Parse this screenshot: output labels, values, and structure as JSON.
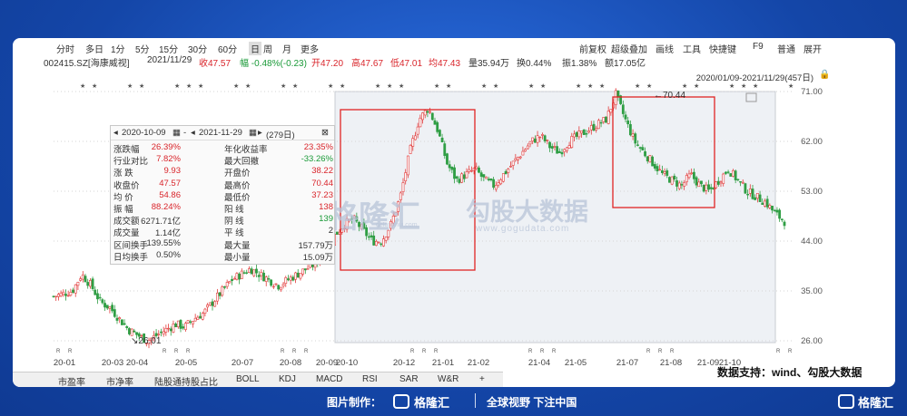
{
  "toolbar": {
    "left": [
      "分时",
      "多日",
      "1分",
      "5分",
      "15分",
      "30分",
      "60分",
      "日",
      "周",
      "月",
      "更多"
    ],
    "right": [
      "前复权",
      "超级叠加",
      "画线",
      "工具",
      "快捷键",
      "F9",
      "普通",
      "展开"
    ]
  },
  "quote": {
    "code": "002415.SZ[海康威视]",
    "date": "2021/11/29",
    "close": "收47.57",
    "change": "幅 -0.48%(-0.23)",
    "open": "开47.20",
    "high": "高47.67",
    "low": "低47.01",
    "avg": "均47.43",
    "volume": "量35.94万",
    "turnover": "换0.44%",
    "amplitude": "振1.38%",
    "amount": "额17.05亿"
  },
  "range_label": "2020/01/09-2021/11/29(457日)",
  "stats": {
    "start": "2020-10-09",
    "end": "2021-11-29",
    "days": "(279日)",
    "rows": [
      {
        "l1": "涨跌幅",
        "v1": "26.39%",
        "l2": "年化收益率",
        "v2": "23.35%",
        "c1": "red",
        "c2": "red"
      },
      {
        "l1": "行业对比",
        "v1": "7.82%",
        "l2": "最大回撤",
        "v2": "-33.26%",
        "c1": "red",
        "c2": "green"
      },
      {
        "l1": "涨 跌",
        "v1": "9.93",
        "l2": "开盘价",
        "v2": "38.22",
        "c1": "red",
        "c2": "red"
      },
      {
        "l1": "收盘价",
        "v1": "47.57",
        "l2": "最高价",
        "v2": "70.44",
        "c1": "red",
        "c2": "red"
      },
      {
        "l1": "均 价",
        "v1": "54.86",
        "l2": "最低价",
        "v2": "37.23",
        "c1": "red",
        "c2": "red"
      },
      {
        "l1": "振 幅",
        "v1": "88.24%",
        "l2": "阳 线",
        "v2": "138",
        "c1": "red",
        "c2": "red"
      },
      {
        "l1": "成交额",
        "v1": "6271.71亿",
        "l2": "阴 线",
        "v2": "139",
        "c1": "dark",
        "c2": "green"
      },
      {
        "l1": "成交量",
        "v1": "1.14亿",
        "l2": "平 线",
        "v2": "2",
        "c1": "dark",
        "c2": "dark"
      },
      {
        "l1": "区间换手",
        "v1": "139.55%",
        "l2": "最大量",
        "v2": "157.79万",
        "c1": "dark",
        "c2": "dark"
      },
      {
        "l1": "日均换手",
        "v1": "0.50%",
        "l2": "最小量",
        "v2": "15.09万",
        "c1": "dark",
        "c2": "dark"
      }
    ]
  },
  "bottom_tabs": [
    "市盈率",
    "市净率",
    "陆股通持股占比",
    "BOLL",
    "KDJ",
    "MACD",
    "RSI",
    "SAR",
    "W&R",
    "+"
  ],
  "source_text": "数据支持：wind、勾股大数据",
  "watermark": {
    "brand": "格隆汇",
    "sub": "gelonghui.com",
    "brand2": "勾股大数据",
    "url": "www.gogudata.com"
  },
  "annotations": {
    "high": "70.44",
    "low": "26.01"
  },
  "footer": {
    "credit": "图片制作：",
    "brand": "格隆汇",
    "slogan": "全球视野 下注中国",
    "brand2": "格隆汇"
  },
  "chart_data": {
    "type": "candlestick",
    "ylim": [
      26,
      71
    ],
    "y_ticks": [
      "71.00",
      "62.00",
      "53.00",
      "44.00",
      "35.00",
      "26.00"
    ],
    "x_labels": [
      "20-01",
      "20-03",
      "20-04",
      "20-05",
      "20-07",
      "20-08",
      "20-09",
      "20-10",
      "20-12",
      "21-01",
      "21-02",
      "21-04",
      "21-05",
      "21-07",
      "21-08",
      "21-09",
      "21-10"
    ],
    "close_path": [
      34,
      34.5,
      35,
      38,
      36,
      33,
      32,
      30,
      28,
      27,
      26.01,
      27,
      28,
      29,
      28.5,
      30,
      31,
      33,
      35,
      37,
      38,
      39,
      38,
      37,
      36,
      37,
      38,
      39,
      40,
      42,
      45,
      47,
      48,
      46,
      44,
      44,
      47,
      52,
      60,
      66,
      68,
      64,
      58,
      55,
      56,
      57,
      55,
      54,
      56,
      58,
      60,
      62,
      63,
      61,
      60,
      62,
      63,
      64,
      65,
      66,
      70.44,
      66,
      62,
      60,
      58,
      56,
      55,
      54,
      56,
      54,
      53,
      55,
      57,
      55,
      53,
      52,
      51,
      49,
      47.57
    ],
    "highlights": [
      "2020-10-09 to 2021-01",
      "2021-07 to 2021-09"
    ],
    "marks": [
      "70.44",
      "26.01"
    ]
  }
}
